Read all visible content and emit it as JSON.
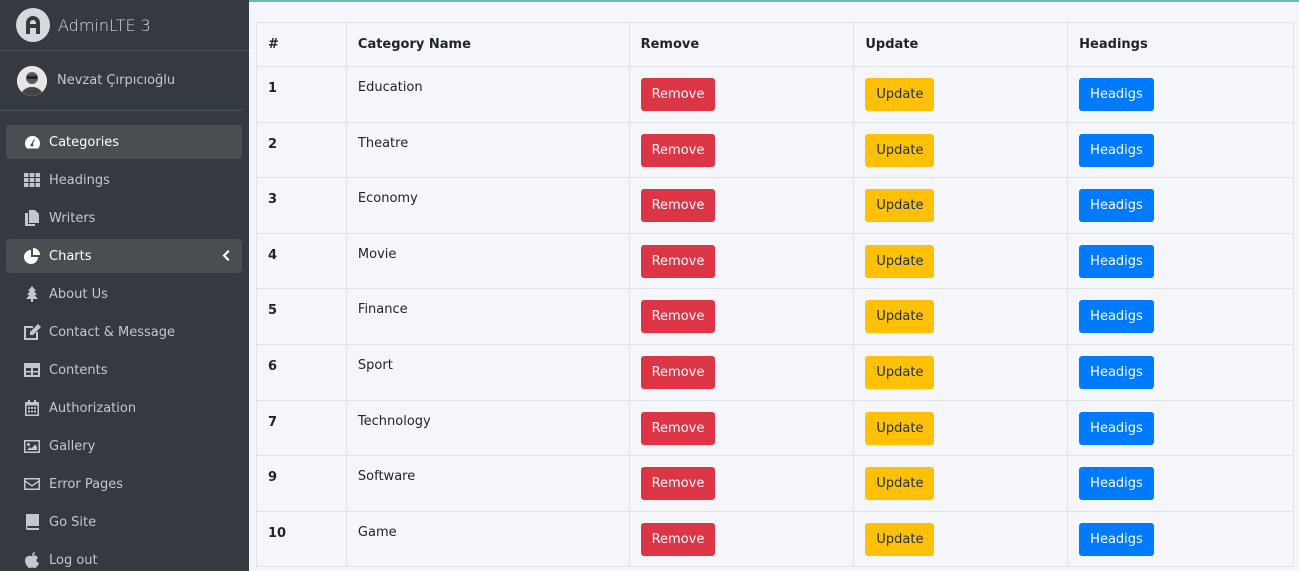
{
  "sidebar": {
    "brand": "AdminLTE 3",
    "user_name": "Nevzat Çırpıcıoğlu",
    "items": [
      {
        "label": "Categories",
        "icon": "tachometer-icon"
      },
      {
        "label": "Headings",
        "icon": "grid-icon"
      },
      {
        "label": "Writers",
        "icon": "copy-icon"
      },
      {
        "label": "Charts",
        "icon": "pie-chart-icon"
      },
      {
        "label": "About Us",
        "icon": "tree-icon"
      },
      {
        "label": "Contact & Message",
        "icon": "edit-icon"
      },
      {
        "label": "Contents",
        "icon": "table-icon"
      },
      {
        "label": "Authorization",
        "icon": "calendar-icon"
      },
      {
        "label": "Gallery",
        "icon": "image-icon"
      },
      {
        "label": "Error Pages",
        "icon": "envelope-icon"
      },
      {
        "label": "Go Site",
        "icon": "book-icon"
      },
      {
        "label": "Log out",
        "icon": "apple-icon"
      }
    ]
  },
  "table": {
    "headers": [
      "#",
      "Category Name",
      "Remove",
      "Update",
      "Headings"
    ],
    "rows": [
      {
        "id": "1",
        "name": "Education"
      },
      {
        "id": "2",
        "name": "Theatre"
      },
      {
        "id": "3",
        "name": "Economy"
      },
      {
        "id": "4",
        "name": "Movie"
      },
      {
        "id": "5",
        "name": "Finance"
      },
      {
        "id": "6",
        "name": "Sport"
      },
      {
        "id": "7",
        "name": "Technology"
      },
      {
        "id": "9",
        "name": "Software"
      },
      {
        "id": "10",
        "name": "Game"
      }
    ],
    "remove_label": "Remove",
    "update_label": "Update",
    "headings_label": "Headigs"
  },
  "colors": {
    "sidebar_bg": "#343a40",
    "danger": "#dc3545",
    "warning": "#ffc107",
    "primary": "#007bff"
  }
}
